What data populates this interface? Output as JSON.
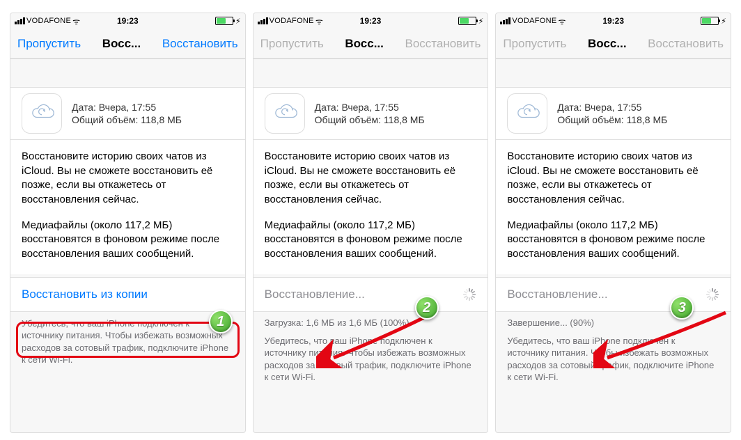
{
  "status_bar": {
    "carrier": "VODAFONE",
    "wifi_glyph": "ᯤ",
    "time": "19:23",
    "bolt_glyph": "⚡︎"
  },
  "nav": {
    "skip_label": "Пропустить",
    "title": "Восс...",
    "restore_label": "Восстановить"
  },
  "backup": {
    "date_label": "Дата:",
    "date_value": "Вчера, 17:55",
    "size_label": "Общий объём:",
    "size_value": "118,8 МБ"
  },
  "description": {
    "p1": "Восстановите историю своих чатов из iCloud. Вы не сможете восстановить её позже, если вы откажетесь от восстановления сейчас.",
    "p2": "Медиафайлы (около 117,2 МБ) восстановятся в фоновом режиме после восстановления ваших сообщений."
  },
  "action": {
    "restore_from_copy": "Восстановить из копии",
    "restoring": "Восстановление..."
  },
  "progress": {
    "download_line": "Загрузка: 1,6 МБ из 1,6 МБ (100%)",
    "finish_line": "Завершение... (90%)"
  },
  "footer_note": "Убедитесь, что ваш iPhone подключен к источнику питания. Чтобы избежать возможных расходов за сотовый трафик, подключите iPhone к сети Wi-Fi.",
  "callouts": {
    "b1": "1",
    "b2": "2",
    "b3": "3"
  }
}
